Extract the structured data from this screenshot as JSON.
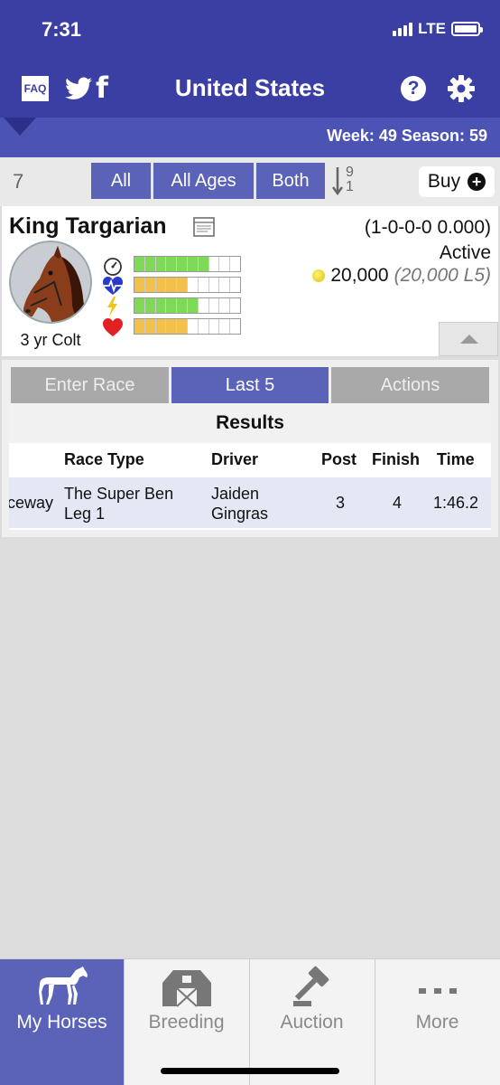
{
  "status_bar": {
    "time": "7:31",
    "network": "LTE"
  },
  "header": {
    "faq_label": "FAQ",
    "title": "United States"
  },
  "season_bar": {
    "week_label": "Week:",
    "week": "49",
    "season_label": "Season:",
    "season": "59"
  },
  "filters": {
    "count": "7",
    "segments": [
      "All",
      "All Ages",
      "Both"
    ],
    "sort_top": "9",
    "sort_bottom": "1",
    "buy_label": "Buy"
  },
  "horse": {
    "name": "King Targarian",
    "record": "(1-0-0-0 0.000)",
    "status": "Active",
    "money": "20,000",
    "money_l5": "(20,000 L5)",
    "age_label": "3 yr Colt",
    "stats": [
      {
        "icon": "speedometer-icon",
        "filled": 7,
        "total": 10,
        "color": "#7ed957"
      },
      {
        "icon": "heart-rate-icon",
        "filled": 5,
        "total": 10,
        "color": "#f3c04a"
      },
      {
        "icon": "lightning-icon",
        "filled": 6,
        "total": 10,
        "color": "#7ed957"
      },
      {
        "icon": "heart-icon",
        "filled": 5,
        "total": 10,
        "color": "#f3c04a"
      }
    ]
  },
  "tabs": [
    "Enter Race",
    "Last 5",
    "Actions"
  ],
  "results": {
    "title": "Results",
    "columns": [
      "Race Type",
      "Driver",
      "Post",
      "Finish",
      "Time"
    ],
    "rows": [
      {
        "track": "ceway",
        "race_type_1": "The Super Ben",
        "race_type_2": "Leg 1",
        "driver_1": "Jaiden",
        "driver_2": "Gingras",
        "post": "3",
        "finish": "4",
        "time": "1:46.2"
      }
    ]
  },
  "bottom_nav": [
    "My Horses",
    "Breeding",
    "Auction",
    "More"
  ],
  "colors": {
    "primary": "#3b3fa3",
    "accent": "#5a63b8",
    "inactive_tab": "#a9a9a9"
  }
}
